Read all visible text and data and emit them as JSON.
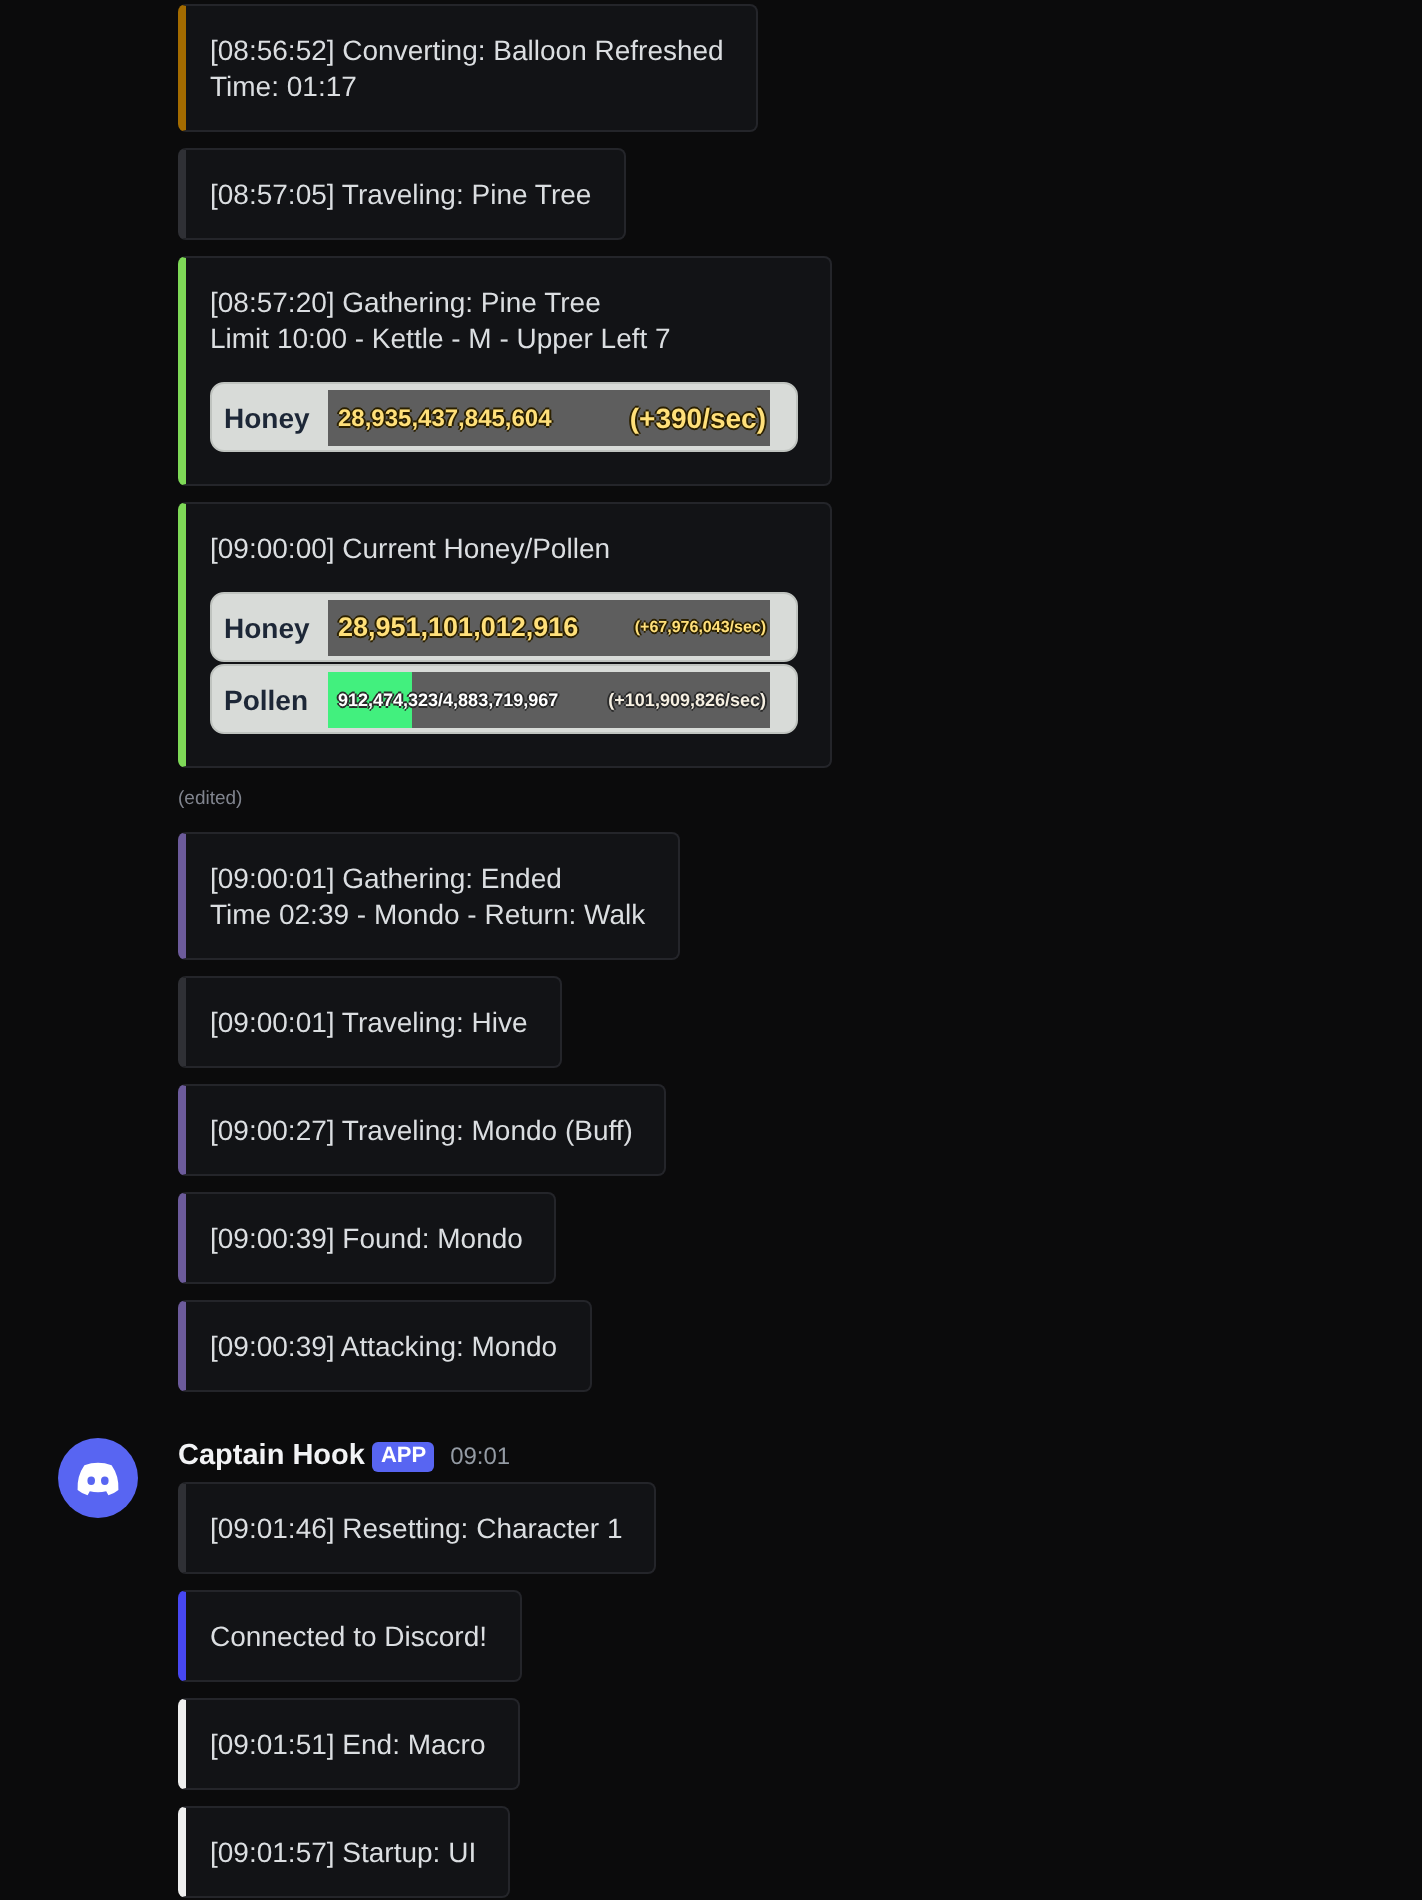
{
  "groups": [
    {
      "embeds": [
        {
          "color": "#a36b00",
          "text": "[08:56:52] Converting: Balloon Refreshed\nTime: 01:17"
        },
        {
          "color": "#2f3035",
          "text": "[08:57:05] Traveling: Pine Tree"
        },
        {
          "color": "#7ed957",
          "text": "[08:57:20] Gathering: Pine Tree\nLimit 10:00 - Kettle - M - Upper Left 7",
          "stats": [
            {
              "kind": "counter",
              "label": "Honey",
              "value": "28,935,437,845,604",
              "rate": "(+390/sec)"
            }
          ]
        },
        {
          "color": "#7ed957",
          "text": "[09:00:00] Current Honey/Pollen",
          "stats": [
            {
              "kind": "counter",
              "label": "Honey",
              "value": "28,951,101,012,916",
              "rate": "(+67,976,043/sec)"
            },
            {
              "kind": "meter",
              "label": "Pollen",
              "value": "912,474,323/4,883,719,967",
              "rate": "(+101,909,826/sec)",
              "level": 0.19
            }
          ],
          "edited": "(edited)"
        },
        {
          "color": "#6c5b9b",
          "text": "[09:00:01] Gathering: Ended\nTime 02:39 - Mondo - Return: Walk"
        },
        {
          "color": "#2f3035",
          "text": "[09:00:01] Traveling: Hive"
        },
        {
          "color": "#6c5b9b",
          "text": "[09:00:27] Traveling: Mondo (Buff)"
        },
        {
          "color": "#6c5b9b",
          "text": "[09:00:39] Found: Mondo"
        },
        {
          "color": "#6c5b9b",
          "text": "[09:00:39] Attacking: Mondo"
        }
      ]
    },
    {
      "author": "Captain Hook",
      "badge": "APP",
      "time": "09:01",
      "embeds": [
        {
          "color": "#2f3035",
          "text": "[09:01:46] Resetting: Character 1"
        },
        {
          "color": "#4747f2",
          "text": "Connected to Discord!"
        },
        {
          "color": "#efefef",
          "text": "[09:01:51] End: Macro"
        },
        {
          "color": "#efefef",
          "text": "[09:01:57] Startup: UI"
        }
      ]
    }
  ]
}
